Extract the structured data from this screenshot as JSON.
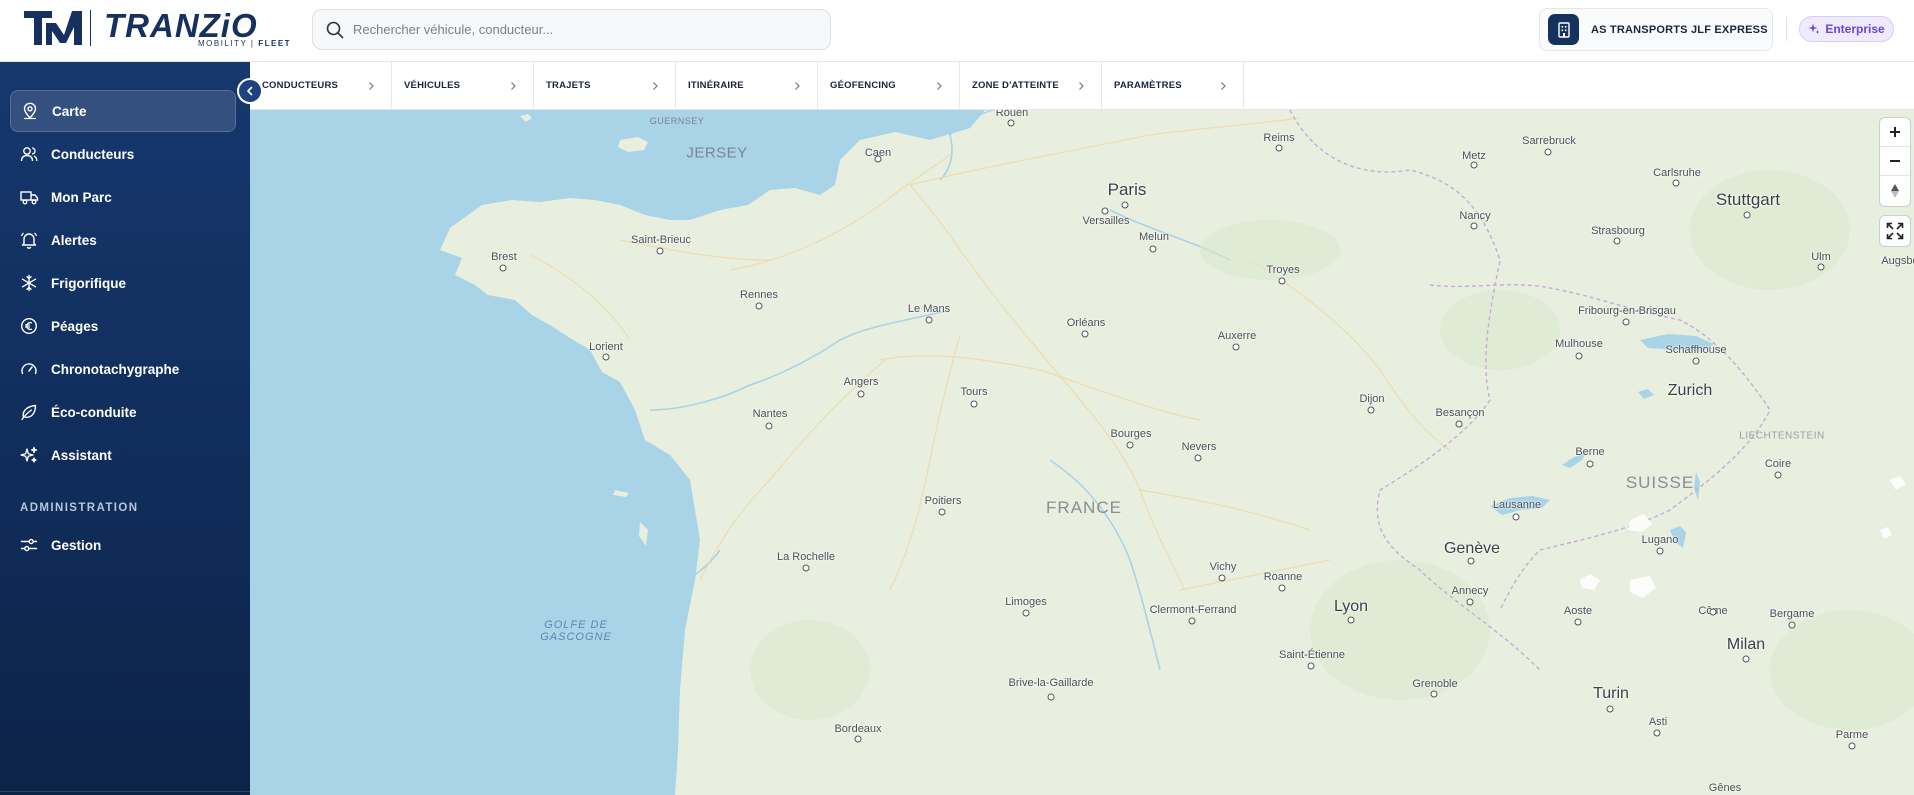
{
  "header": {
    "logo_text": "TRANZiO",
    "logo_sub_a": "MOBILITY",
    "logo_sub_b": "FLEET",
    "search_placeholder": "Rechercher véhicule, conducteur...",
    "company_name": "AS TRANSPORTS JLF EXPRESS",
    "plan_label": "Enterprise"
  },
  "sidebar": {
    "items": [
      {
        "label": "Carte",
        "icon": "map-pin-icon"
      },
      {
        "label": "Conducteurs",
        "icon": "users-icon"
      },
      {
        "label": "Mon Parc",
        "icon": "truck-icon"
      },
      {
        "label": "Alertes",
        "icon": "bell-icon"
      },
      {
        "label": "Frigorifique",
        "icon": "snowflake-icon"
      },
      {
        "label": "Péages",
        "icon": "euro-icon"
      },
      {
        "label": "Chronotachygraphe",
        "icon": "gauge-icon"
      },
      {
        "label": "Éco-conduite",
        "icon": "leaf-icon"
      },
      {
        "label": "Assistant",
        "icon": "sparkles-icon"
      }
    ],
    "section_title": "ADMINISTRATION",
    "admin_items": [
      {
        "label": "Gestion",
        "icon": "sliders-icon"
      }
    ]
  },
  "tabs": [
    "CONDUCTEURS",
    "VÉHICULES",
    "TRAJETS",
    "ITINÉRAIRE",
    "GÉOFENCING",
    "ZONE D'ATTEINTE",
    "PARAMÈTRES"
  ],
  "map": {
    "country_label": "FRANCE",
    "swiss_label": "SUISSE",
    "liechtenstein_label": "LIECHTENSTEIN",
    "sea_label_1": "GOLFE DE",
    "sea_label_2": "GASCOGNE",
    "jersey_label": "JERSEY",
    "guernsey_label": "GUERNSEY",
    "cities": {
      "paris": "Paris",
      "versailles": "Versailles",
      "melun": "Melun",
      "rouen": "Rouen",
      "caen": "Caen",
      "reims": "Reims",
      "metz": "Metz",
      "sarrebruck": "Sarrebruck",
      "carlsruhe": "Carlsruhe",
      "stuttgart": "Stuttgart",
      "nancy": "Nancy",
      "strasbourg": "Strasbourg",
      "ulm": "Ulm",
      "augsbourg": "Augsbo",
      "brest": "Brest",
      "saint_brieuc": "Saint-Brieuc",
      "rennes": "Rennes",
      "lorient": "Lorient",
      "le_mans": "Le Mans",
      "orleans": "Orléans",
      "troyes": "Troyes",
      "auxerre": "Auxerre",
      "fribourg": "Fribourg-en-Brisgau",
      "mulhouse": "Mulhouse",
      "schaffhouse": "Schaffhouse",
      "zurich": "Zurich",
      "angers": "Angers",
      "tours": "Tours",
      "nantes": "Nantes",
      "dijon": "Dijon",
      "besancon": "Besançon",
      "bourges": "Bourges",
      "nevers": "Nevers",
      "berne": "Berne",
      "coire": "Coire",
      "poitiers": "Poitiers",
      "lausanne": "Lausanne",
      "la_rochelle": "La Rochelle",
      "vichy": "Vichy",
      "roanne": "Roanne",
      "geneve": "Genève",
      "annecy": "Annecy",
      "lugano": "Lugano",
      "limoges": "Limoges",
      "clermont": "Clermont-Ferrand",
      "lyon": "Lyon",
      "aoste": "Aoste",
      "come": "Côme",
      "bergame": "Bergame",
      "saint_etienne": "Saint-Étienne",
      "milan": "Milan",
      "brive": "Brive-la-Gaillarde",
      "grenoble": "Grenoble",
      "turin": "Turin",
      "bordeaux": "Bordeaux",
      "asti": "Asti",
      "parme": "Parme",
      "genes": "Gênes"
    }
  },
  "colors": {
    "sidebar": "#16386e",
    "water": "#a9d3e6",
    "land": "#e8efdf",
    "accent_purple": "#6b45d8"
  }
}
